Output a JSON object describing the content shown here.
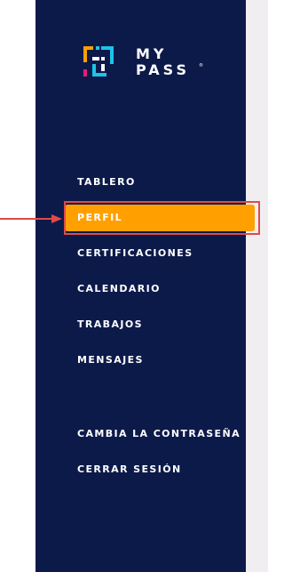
{
  "colors": {
    "sidebar_bg": "#0c1a4a",
    "active_bg": "#ffa000",
    "annotation": "#e04a4a",
    "right_gutter": "#f0eef0"
  },
  "logo": {
    "line1": "MY",
    "line2": "PASS",
    "reg": "®",
    "icon": "mypass-logo-icon"
  },
  "nav": {
    "items": [
      {
        "label": "TABLERO",
        "active": false
      },
      {
        "label": "PERFIL",
        "active": true
      },
      {
        "label": "CERTIFICACIONES",
        "active": false
      },
      {
        "label": "CALENDARIO",
        "active": false
      },
      {
        "label": "TRABAJOS",
        "active": false
      },
      {
        "label": "MENSAJES",
        "active": false
      }
    ],
    "account_items": [
      {
        "label": "CAMBIA LA CONTRASEÑA"
      },
      {
        "label": "CERRAR SESIÓN"
      }
    ]
  },
  "annotation": {
    "icon": "pointer-arrow-icon",
    "target": "PERFIL"
  }
}
